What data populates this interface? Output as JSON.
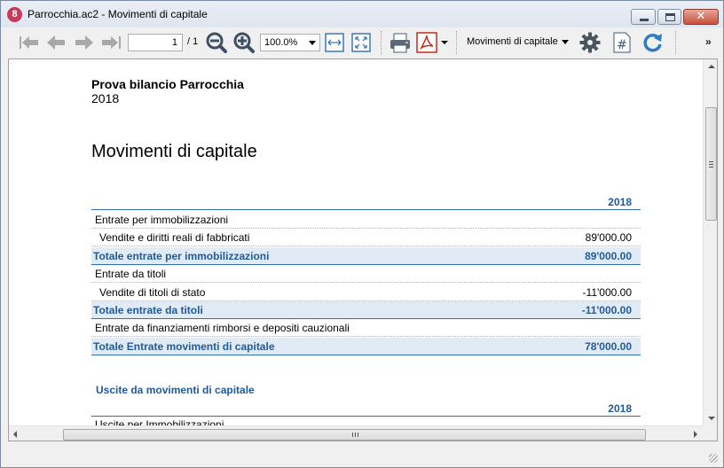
{
  "window": {
    "title": "Parrocchia.ac2 - Movimenti di capitale",
    "app_icon_text": "8"
  },
  "toolbar": {
    "page_value": "1",
    "page_total": "/ 1",
    "zoom_value": "100.0%",
    "report_name": "Movimenti di capitale",
    "overflow_label": "»"
  },
  "report": {
    "header_title": "Prova bilancio Parrocchia",
    "header_year": "2018",
    "title": "Movimenti di capitale",
    "column_year": "2018",
    "rows": [
      {
        "label": "Entrate per immobilizzazioni",
        "amount": "",
        "type": "level1"
      },
      {
        "label": "Vendite e diritti reali di fabbricati",
        "amount": "89'000.00",
        "type": "level2"
      },
      {
        "label": "Totale entrate per immobilizzazioni",
        "amount": "89'000.00",
        "type": "total"
      },
      {
        "label": "Entrate da titoli",
        "amount": "",
        "type": "level1"
      },
      {
        "label": "Vendite di titoli di stato",
        "amount": "-11'000.00",
        "type": "level2"
      },
      {
        "label": "Totale entrate da titoli",
        "amount": "-11'000.00",
        "type": "total"
      },
      {
        "label": "Entrate da finanziamenti rimborsi e depositi cauzionali",
        "amount": "",
        "type": "level1"
      },
      {
        "label": "Totale Entrate movimenti di capitale",
        "amount": "78'000.00",
        "type": "grand"
      }
    ],
    "section2_title": "Uscite da movimenti di capitale",
    "section2_year": "2018",
    "section2_first_row": "Uscite per Immobilizzazioni"
  },
  "colors": {
    "accent": "#1f5a9a",
    "total_row_bg": "#e1ebf5",
    "rule": "#3070a8"
  }
}
